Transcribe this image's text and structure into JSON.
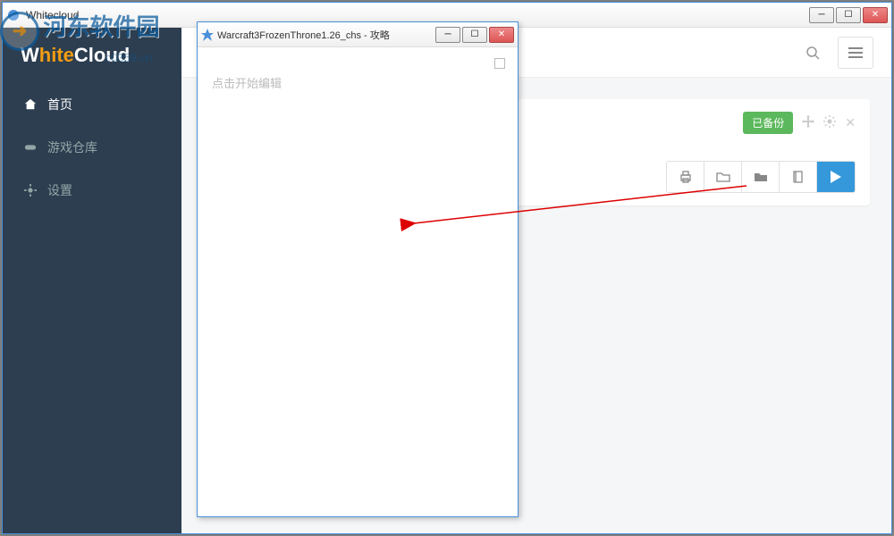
{
  "main_window": {
    "title": "Whitecloud",
    "controls": {
      "min": "─",
      "max": "☐",
      "close": "✕"
    }
  },
  "sidebar": {
    "logo_pre": "W",
    "logo_accent": "hite",
    "logo_post": "Cloud",
    "items": [
      {
        "label": "首页",
        "icon": "home"
      },
      {
        "label": "游戏仓库",
        "icon": "gamepad"
      },
      {
        "label": "设置",
        "icon": "gear"
      }
    ]
  },
  "topbar": {
    "search_icon": "search",
    "menu_icon": "menu"
  },
  "card": {
    "badge": "已备份",
    "icons": {
      "move": "✥",
      "gear": "✿",
      "close": "✕"
    },
    "actions": {
      "print": "⎙",
      "folder_open": "📂",
      "folder": "📁",
      "book": "📕",
      "play": "▶"
    }
  },
  "popup": {
    "title": "Warcraft3FrozenThrone1.26_chs - 攻略",
    "placeholder": "点击开始编辑",
    "controls": {
      "min": "─",
      "max": "☐",
      "close": "✕"
    }
  },
  "watermark": {
    "text": "河东软件园",
    "url": "c0359.cn"
  }
}
